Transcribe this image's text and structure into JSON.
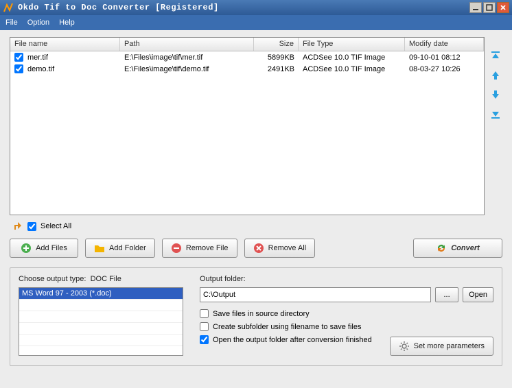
{
  "title": "Okdo Tif to Doc Converter [Registered]",
  "menu": {
    "file": "File",
    "option": "Option",
    "help": "Help"
  },
  "columns": {
    "name": "File name",
    "path": "Path",
    "size": "Size",
    "type": "File Type",
    "date": "Modify date"
  },
  "files": [
    {
      "checked": true,
      "name": "mer.tif",
      "path": "E:\\Files\\image\\tif\\mer.tif",
      "size": "5899KB",
      "type": "ACDSee 10.0 TIF Image",
      "date": "09-10-01 08:12"
    },
    {
      "checked": true,
      "name": "demo.tif",
      "path": "E:\\Files\\image\\tif\\demo.tif",
      "size": "2491KB",
      "type": "ACDSee 10.0 TIF Image",
      "date": "08-03-27 10:26"
    }
  ],
  "select_all": "Select All",
  "buttons": {
    "add_files": "Add Files",
    "add_folder": "Add Folder",
    "remove_file": "Remove File",
    "remove_all": "Remove All",
    "convert": "Convert"
  },
  "output_type_label": "Choose output type:",
  "output_type_value": "DOC File",
  "output_type_option": "MS Word 97 - 2003 (*.doc)",
  "output_folder_label": "Output folder:",
  "output_folder_value": "C:\\Output",
  "browse": "...",
  "open": "Open",
  "checks": {
    "save_src": "Save files in source directory",
    "subfolder": "Create subfolder using filename to save files",
    "open_after": "Open the output folder after conversion finished"
  },
  "more_params": "Set more parameters"
}
